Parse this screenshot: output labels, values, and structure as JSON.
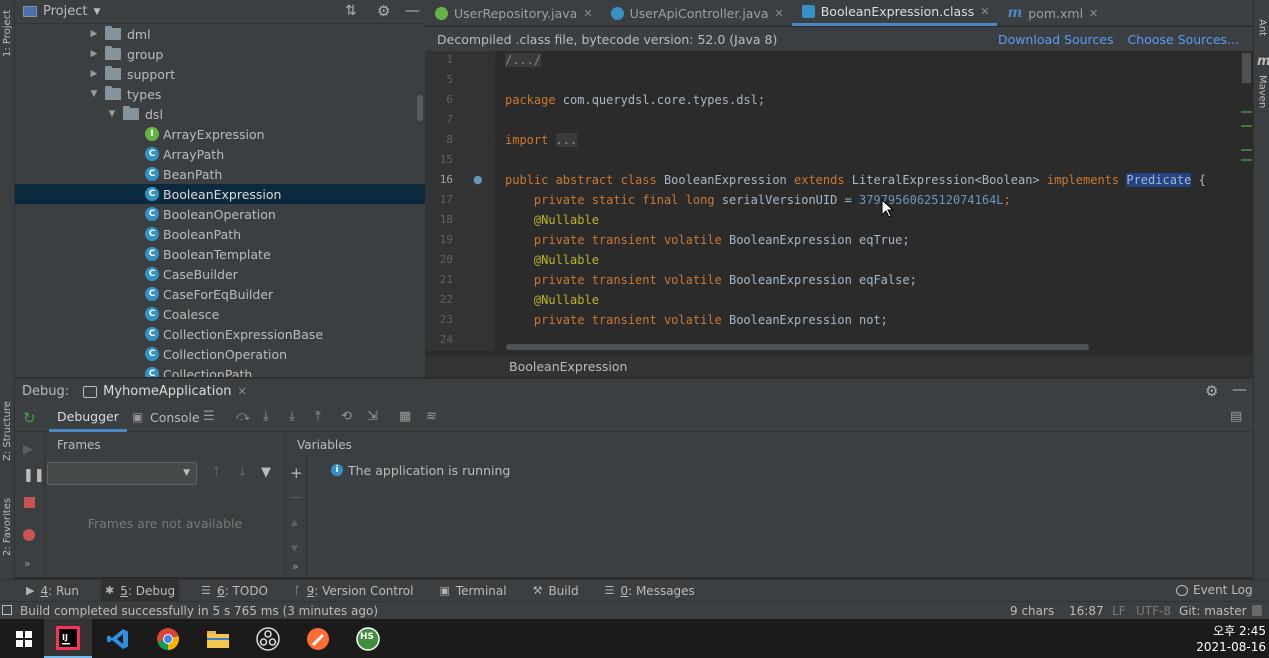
{
  "left_stripe": {
    "project_tab": "1: Project",
    "structure_tab": "Z: Structure",
    "favorites_tab": "2: Favorites"
  },
  "right_stripe": {
    "ant_tab": "Ant",
    "maven_tab": "Maven",
    "maven_icon": "m"
  },
  "project_panel": {
    "title": "Project",
    "tree": [
      {
        "label": "dml",
        "type": "folder",
        "expanded": false
      },
      {
        "label": "group",
        "type": "folder",
        "expanded": false
      },
      {
        "label": "support",
        "type": "folder",
        "expanded": false
      },
      {
        "label": "types",
        "type": "folder",
        "expanded": true
      },
      {
        "label": "dsl",
        "type": "folder",
        "expanded": true
      },
      {
        "label": "ArrayExpression",
        "type": "interface"
      },
      {
        "label": "ArrayPath",
        "type": "class"
      },
      {
        "label": "BeanPath",
        "type": "class"
      },
      {
        "label": "BooleanExpression",
        "type": "class",
        "selected": true
      },
      {
        "label": "BooleanOperation",
        "type": "class"
      },
      {
        "label": "BooleanPath",
        "type": "class"
      },
      {
        "label": "BooleanTemplate",
        "type": "class"
      },
      {
        "label": "CaseBuilder",
        "type": "class"
      },
      {
        "label": "CaseForEqBuilder",
        "type": "class"
      },
      {
        "label": "Coalesce",
        "type": "class"
      },
      {
        "label": "CollectionExpressionBase",
        "type": "class"
      },
      {
        "label": "CollectionOperation",
        "type": "class"
      },
      {
        "label": "CollectionPath",
        "type": "class"
      }
    ]
  },
  "editor_tabs": [
    {
      "label": "UserRepository.java",
      "icon": "interface-icon",
      "active": false
    },
    {
      "label": "UserApiController.java",
      "icon": "class-icon",
      "active": false
    },
    {
      "label": "BooleanExpression.class",
      "icon": "class-file-icon",
      "active": true
    },
    {
      "label": "pom.xml",
      "icon": "maven-icon",
      "active": false
    }
  ],
  "banner": {
    "message": "Decompiled .class file, bytecode version: 52.0 (Java 8)",
    "download_sources": "Download Sources",
    "choose_sources": "Choose Sources..."
  },
  "editor": {
    "line_numbers": [
      "1",
      "5",
      "6",
      "7",
      "8",
      "15",
      "16",
      "17",
      "18",
      "19",
      "20",
      "21",
      "22",
      "23",
      "24"
    ],
    "current_line": "16",
    "lines": [
      [
        {
          "t": "/.../",
          "c": "fold"
        }
      ],
      [],
      [
        {
          "t": "package ",
          "c": "kw"
        },
        {
          "t": "com.querydsl.core.types.dsl;",
          "c": ""
        }
      ],
      [],
      [
        {
          "t": "import ",
          "c": "kw"
        },
        {
          "t": "...",
          "c": "fold"
        }
      ],
      [],
      [
        {
          "t": "public abstract class ",
          "c": "kw"
        },
        {
          "t": "BooleanExpression ",
          "c": ""
        },
        {
          "t": "extends ",
          "c": "kw"
        },
        {
          "t": "LiteralExpression<Boolean> ",
          "c": ""
        },
        {
          "t": "implements ",
          "c": "kw"
        },
        {
          "t": "Predicate",
          "c": "hl"
        },
        {
          "t": " {",
          "c": ""
        }
      ],
      [
        {
          "t": "    private static final long ",
          "c": "kw"
        },
        {
          "t": "serialVersionUID = ",
          "c": ""
        },
        {
          "t": "3797956062512074164L",
          "c": "num"
        },
        {
          "t": ";",
          "c": "kw"
        }
      ],
      [
        {
          "t": "    @Nullable",
          "c": ""
        }
      ],
      [
        {
          "t": "    private transient volatile ",
          "c": "kw"
        },
        {
          "t": "BooleanExpression eqTrue;",
          "c": ""
        }
      ],
      [
        {
          "t": "    @Nullable",
          "c": ""
        }
      ],
      [
        {
          "t": "    private transient volatile ",
          "c": "kw"
        },
        {
          "t": "BooleanExpression eqFalse;",
          "c": ""
        }
      ],
      [
        {
          "t": "    @Nullable",
          "c": ""
        }
      ],
      [
        {
          "t": "    private transient volatile ",
          "c": "kw"
        },
        {
          "t": "BooleanExpression not;",
          "c": ""
        }
      ],
      []
    ],
    "breadcrumb": "BooleanExpression"
  },
  "debug": {
    "title": "Debug:",
    "config": "MyhomeApplication",
    "tabs": {
      "debugger": "Debugger",
      "console": "Console"
    },
    "frames_header": "Frames",
    "frames_empty": "Frames are not available",
    "variables_header": "Variables",
    "running_message": "The application is running"
  },
  "tool_windows": [
    {
      "num": "4",
      "label": ": Run",
      "icon": "run-icon",
      "active": false
    },
    {
      "num": "5",
      "label": ": Debug",
      "icon": "debug-icon",
      "active": true
    },
    {
      "num": "6",
      "label": ": TODO",
      "icon": "todo-icon",
      "active": false
    },
    {
      "num": "9",
      "label": ": Version Control",
      "icon": "vcs-icon",
      "active": false
    },
    {
      "num": "",
      "label": "Terminal",
      "icon": "terminal-icon",
      "active": false
    },
    {
      "num": "",
      "label": "Build",
      "icon": "build-icon",
      "active": false
    },
    {
      "num": "0",
      "label": ": Messages",
      "icon": "messages-icon",
      "active": false
    }
  ],
  "event_log": "Event Log",
  "status": {
    "message": "Build completed successfully in 5 s 765 ms (3 minutes ago)",
    "chars": "9 chars",
    "position": "16:87",
    "line_sep": "LF",
    "encoding": "UTF-8",
    "git": "Git: master"
  },
  "taskbar": {
    "apps": [
      "intellij-icon",
      "vscode-icon",
      "chrome-icon",
      "file-explorer-icon",
      "obs-icon",
      "postman-icon",
      "hs-icon"
    ],
    "hs_label": "HS",
    "time": "오후 2:45",
    "date": "2021-08-16"
  },
  "colors": {
    "accent": "#4a88c7",
    "selection": "#0d293e",
    "keyword": "#cc7832",
    "number": "#6897bb"
  }
}
